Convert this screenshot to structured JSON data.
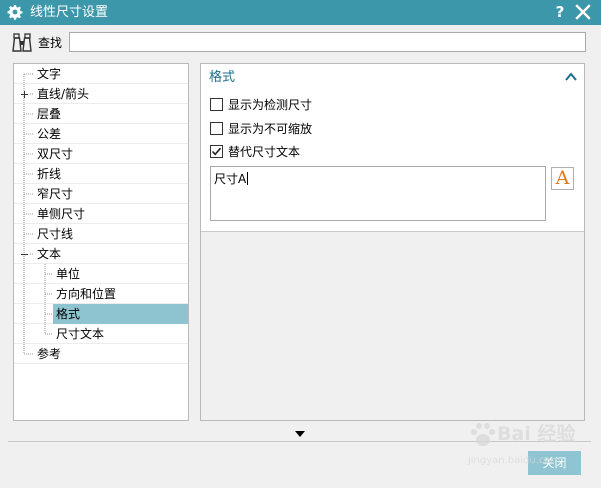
{
  "window": {
    "title": "线性尺寸设置",
    "help_label": "?"
  },
  "search": {
    "label": "查找",
    "value": ""
  },
  "tree": {
    "items": [
      {
        "label": "文字",
        "level": 0,
        "expander": ""
      },
      {
        "label": "直线/箭头",
        "level": 0,
        "expander": "+"
      },
      {
        "label": "层叠",
        "level": 0,
        "expander": ""
      },
      {
        "label": "公差",
        "level": 0,
        "expander": ""
      },
      {
        "label": "双尺寸",
        "level": 0,
        "expander": ""
      },
      {
        "label": "折线",
        "level": 0,
        "expander": ""
      },
      {
        "label": "窄尺寸",
        "level": 0,
        "expander": ""
      },
      {
        "label": "单侧尺寸",
        "level": 0,
        "expander": ""
      },
      {
        "label": "尺寸线",
        "level": 0,
        "expander": ""
      },
      {
        "label": "文本",
        "level": 0,
        "expander": "-"
      },
      {
        "label": "单位",
        "level": 1,
        "expander": ""
      },
      {
        "label": "方向和位置",
        "level": 1,
        "expander": ""
      },
      {
        "label": "格式",
        "level": 1,
        "expander": "",
        "selected": true
      },
      {
        "label": "尺寸文本",
        "level": 1,
        "expander": ""
      },
      {
        "label": "参考",
        "level": 0,
        "expander": ""
      }
    ]
  },
  "format_group": {
    "title": "格式",
    "checkboxes": [
      {
        "label": "显示为检测尺寸",
        "checked": false
      },
      {
        "label": "显示为不可缩放",
        "checked": false
      },
      {
        "label": "替代尺寸文本",
        "checked": true
      }
    ],
    "text_value": "尺寸A",
    "font_button_glyph": "A"
  },
  "footer": {
    "button_label": "关闭"
  },
  "watermark": {
    "text": "Bai 经验",
    "url": "jingyan.baidu.com"
  },
  "colors": {
    "titlebar": "#3d97aa",
    "selection": "#8dc4d0",
    "accent_text": "#1a6f8c",
    "font_icon": "#e07a1c"
  }
}
